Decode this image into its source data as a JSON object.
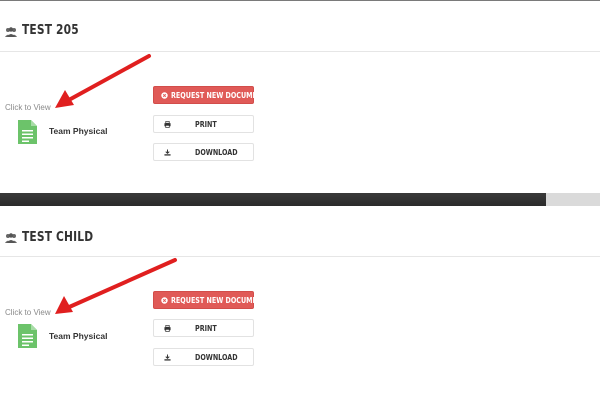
{
  "panels": [
    {
      "title": "TEST 205",
      "click_label": "Click to View",
      "document_name": "Team Physical",
      "buttons": {
        "request": "REQUEST NEW DOCUMENT",
        "print": "PRINT",
        "download": "DOWNLOAD"
      }
    },
    {
      "title": "TEST CHILD",
      "click_label": "Click to View",
      "document_name": "Team Physical",
      "buttons": {
        "request": "REQUEST NEW DOCUMENT",
        "print": "PRINT",
        "download": "DOWNLOAD"
      }
    }
  ],
  "icons": [
    "users-icon",
    "document-icon",
    "x-circle-icon",
    "print-icon",
    "download-icon",
    "red-arrow-annotation"
  ],
  "colors": {
    "request_button": "#e05a57",
    "document_icon": "#6cc36a",
    "annotation_arrow": "#e01f1f"
  }
}
